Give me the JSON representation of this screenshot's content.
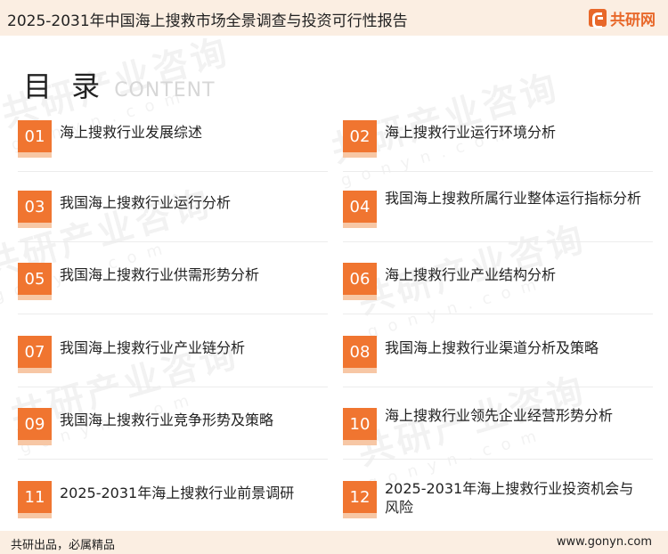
{
  "header": {
    "title": "2025-2031年中国海上搜救市场全景调查与投资可行性报告",
    "logo_text": "共研网"
  },
  "toc": {
    "title": "目 录",
    "subtitle": "CONTENT"
  },
  "items": [
    {
      "num": "01",
      "label": "海上搜救行业发展综述"
    },
    {
      "num": "02",
      "label": "海上搜救行业运行环境分析"
    },
    {
      "num": "03",
      "label": "我国海上搜救行业运行分析"
    },
    {
      "num": "04",
      "label": "我国海上搜救所属行业整体运行指标分析"
    },
    {
      "num": "05",
      "label": "我国海上搜救行业供需形势分析"
    },
    {
      "num": "06",
      "label": "海上搜救行业产业结构分析"
    },
    {
      "num": "07",
      "label": "我国海上搜救行业产业链分析"
    },
    {
      "num": "08",
      "label": "我国海上搜救行业渠道分析及策略"
    },
    {
      "num": "09",
      "label": "我国海上搜救行业竞争形势及策略"
    },
    {
      "num": "10",
      "label": "海上搜救行业领先企业经营形势分析"
    },
    {
      "num": "11",
      "label": "2025-2031年海上搜救行业前景调研"
    },
    {
      "num": "12",
      "label": "2025-2031年海上搜救行业投资机会与风险"
    }
  ],
  "watermark": {
    "text": "共研产业咨询",
    "domain": "gonyn.com"
  },
  "footer": {
    "slogan": "共研出品，必属精品",
    "url": "www.gonyn.com"
  }
}
